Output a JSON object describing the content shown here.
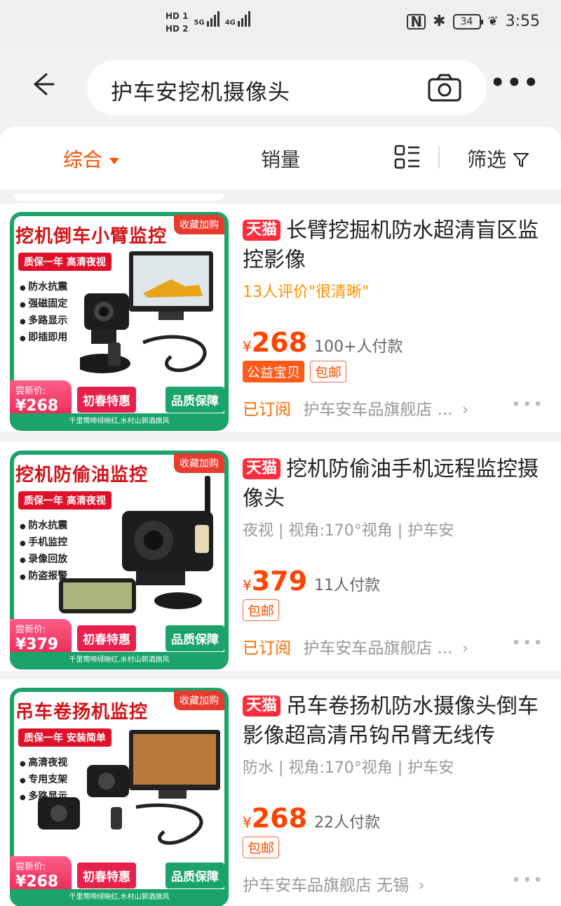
{
  "status": {
    "hd1": "HD 1",
    "hd2": "HD 2",
    "net1": "5G",
    "net2": "4G",
    "battery": "34",
    "time": "3:55"
  },
  "search": {
    "query": "护车安挖机摄像头"
  },
  "tabs": {
    "comprehensive": "综合",
    "sales": "销量",
    "filter": "筛选"
  },
  "products": [
    {
      "thumb_head": "挖机倒车小臂监控",
      "thumb_fav": "收藏加购",
      "thumb_badge": "质保一年 高清夜视",
      "thumb_features": [
        "防水抗震",
        "强磁固定",
        "多路显示",
        "即插即用"
      ],
      "thumb_price_label": "尝新价:",
      "thumb_price": "¥268",
      "thumb_spring": "初春特惠",
      "thumb_quality": "品质保障",
      "thumb_foot": "千里莺啼绿映红,水村山郭酒旗风",
      "tmall": "天猫",
      "title": "长臂挖掘机防水超清盲区监控影像",
      "sub": "13人评价\"很清晰\"",
      "yen": "¥",
      "price": "268",
      "sales": "100+人付款",
      "tag_charity": "公益宝贝",
      "tag_shipping": "包邮",
      "subscribed": "已订阅",
      "shop": "护车安车品旗舰店 ..."
    },
    {
      "thumb_head": "挖机防偷油监控",
      "thumb_fav": "收藏加购",
      "thumb_badge": "质保一年 高清夜视",
      "thumb_features": [
        "防水抗震",
        "手机监控",
        "录像回放",
        "防盗报警"
      ],
      "thumb_price_label": "尝新价:",
      "thumb_price": "¥379",
      "thumb_spring": "初春特惠",
      "thumb_quality": "品质保障",
      "thumb_foot": "千里莺啼绿映红,水村山郭酒旗风",
      "tmall": "天猫",
      "title": "挖机防偷油手机远程监控摄像头",
      "sub": "夜视 | 视角:170°视角 | 护车安",
      "yen": "¥",
      "price": "379",
      "sales": "11人付款",
      "tag_shipping": "包邮",
      "subscribed": "已订阅",
      "shop": "护车安车品旗舰店 ..."
    },
    {
      "thumb_head": "吊车卷扬机监控",
      "thumb_fav": "收藏加购",
      "thumb_badge": "质保一年 安装简单",
      "thumb_features": [
        "高清夜视",
        "专用支架",
        "多路显示"
      ],
      "thumb_price_label": "尝新价:",
      "thumb_price": "¥268",
      "thumb_spring": "初春特惠",
      "thumb_quality": "品质保障",
      "thumb_foot": "千里莺啼绿映红,水村山郭酒旗风",
      "tmall": "天猫",
      "title": "吊车卷扬机防水摄像头倒车影像超高清吊钩吊臂无线传",
      "sub": "防水 | 视角:170°视角 | 护车安",
      "yen": "¥",
      "price": "268",
      "sales": "22人付款",
      "tag_shipping": "包邮",
      "shop": "护车安车品旗舰店 无锡"
    }
  ],
  "colors": {
    "accent": "#ff5000",
    "price": "#ff4400",
    "tmall": "#ff2c3d",
    "thumb_green": "#1aa36a"
  }
}
